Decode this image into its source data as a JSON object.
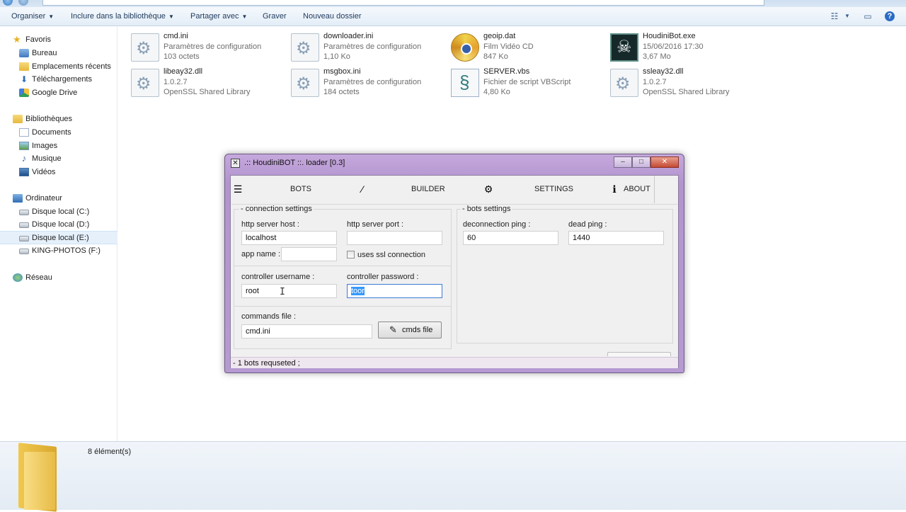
{
  "toolbar": {
    "organize": "Organiser",
    "include_library": "Inclure dans la bibliothèque",
    "share_with": "Partager avec",
    "burn": "Graver",
    "new_folder": "Nouveau dossier"
  },
  "nav": {
    "favorites": "Favoris",
    "desktop": "Bureau",
    "recent_places": "Emplacements récents",
    "downloads": "Téléchargements",
    "google_drive": "Google Drive",
    "libraries": "Bibliothèques",
    "documents": "Documents",
    "images": "Images",
    "music": "Musique",
    "videos": "Vidéos",
    "computer": "Ordinateur",
    "drive_c": "Disque local (C:)",
    "drive_d": "Disque local (D:)",
    "drive_e": "Disque local (E:)",
    "drive_f": "KING-PHOTOS (F:)",
    "network": "Réseau"
  },
  "files": [
    {
      "name": "cmd.ini",
      "type": "Paramètres de configuration",
      "size": "103 octets"
    },
    {
      "name": "downloader.ini",
      "type": "Paramètres de configuration",
      "size": "1,10 Ko"
    },
    {
      "name": "geoip.dat",
      "type": "Film Vidéo CD",
      "size": "847 Ko"
    },
    {
      "name": "HoudiniBot.exe",
      "type": "15/06/2016 17:30",
      "size": "3,67 Mo"
    },
    {
      "name": "libeay32.dll",
      "type": "1.0.2.7",
      "size": "OpenSSL Shared Library"
    },
    {
      "name": "msgbox.ini",
      "type": "Paramètres de configuration",
      "size": "184 octets"
    },
    {
      "name": "SERVER.vbs",
      "type": "Fichier de script VBScript",
      "size": "4,80 Ko"
    },
    {
      "name": "ssleay32.dll",
      "type": "1.0.2.7",
      "size": "OpenSSL Shared Library"
    }
  ],
  "status": {
    "item_count": "8 élément(s)"
  },
  "houdini": {
    "title": ".:: HoudiniBOT ::. loader [0.3]",
    "tabs": {
      "bots": "BOTS",
      "builder": "BUILDER",
      "settings": "SETTINGS",
      "about": "ABOUT"
    },
    "connection": {
      "group_title": "- connection settings",
      "host_label": "http server host :",
      "host_value": "localhost",
      "port_label": "http server port :",
      "port_value": "",
      "app_label": "app name :",
      "app_value": "",
      "ssl_label": "uses ssl connection",
      "user_label": "controller username :",
      "user_value": "root",
      "pass_label": "controller password :",
      "pass_value": "toor",
      "cmds_label": "commands file :",
      "cmds_value": "cmd.ini",
      "cmds_button": "cmds file"
    },
    "bots_settings": {
      "group_title": "- bots settings",
      "deconn_label": "deconnection ping :",
      "deconn_value": "60",
      "dead_label": "dead ping :",
      "dead_value": "1440"
    },
    "status": "- 1 bots requseted ;"
  }
}
